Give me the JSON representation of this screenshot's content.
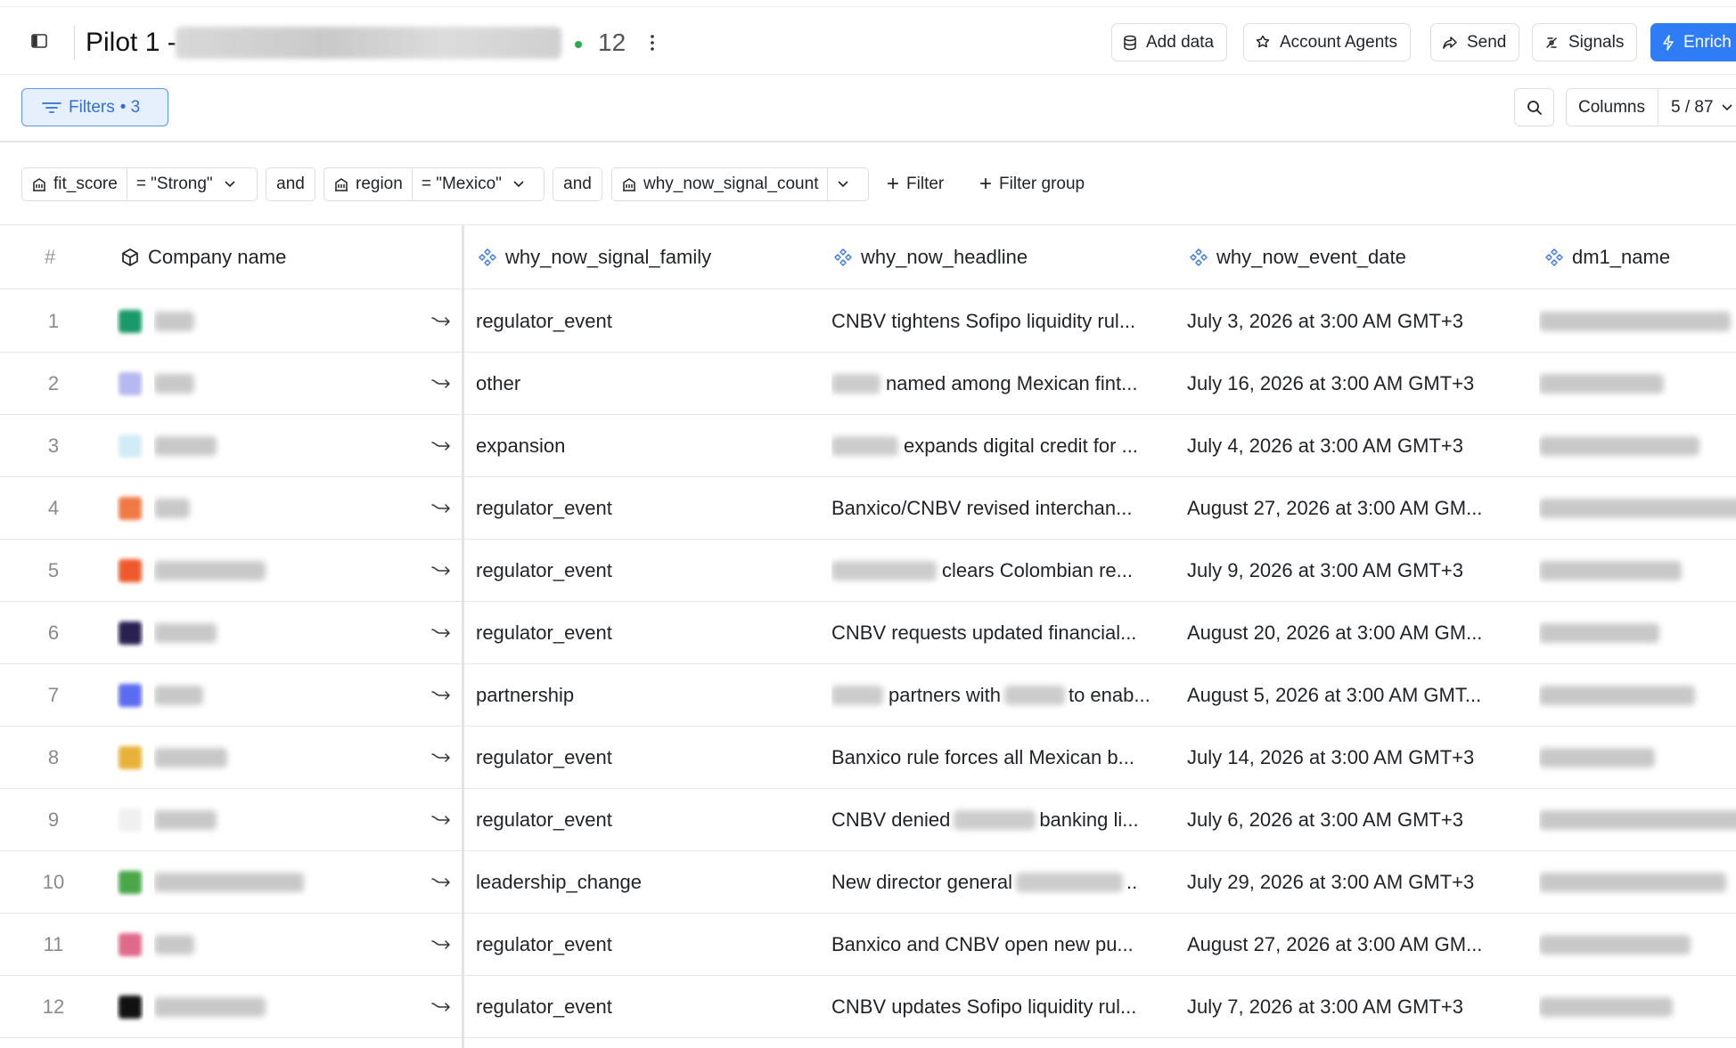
{
  "header": {
    "title": "Pilot 1 -",
    "row_count": "12",
    "buttons": {
      "add_data": "Add data",
      "account_agents": "Account Agents",
      "send": "Send",
      "signals": "Signals",
      "enrich": "Enrich"
    }
  },
  "toolbar": {
    "filters_label": "Filters",
    "filters_count": "• 3",
    "columns_label": "Columns",
    "columns_count": "5 / 87"
  },
  "filters": {
    "chip1": {
      "field": "fit_score",
      "value": "= \"Strong\""
    },
    "and1": "and",
    "chip2": {
      "field": "region",
      "value": "= \"Mexico\""
    },
    "and2": "and",
    "chip3": {
      "field": "why_now_signal_count"
    },
    "add_filter": "Filter",
    "add_group": "Filter group"
  },
  "table": {
    "columns": {
      "num": "#",
      "company": "Company name",
      "family": "why_now_signal_family",
      "headline": "why_now_headline",
      "date": "why_now_event_date",
      "dm": "dm1_name"
    },
    "rows": [
      {
        "num": "1",
        "logo_color": "#1a9a6a",
        "family": "regulator_event",
        "headline": "CNBV tightens Sofipo liquidity rul...",
        "date": "July 3, 2026 at 3:00 AM GMT+3"
      },
      {
        "num": "2",
        "logo_color": "#b8b8f0",
        "family": "other",
        "headline": "named among Mexican fint...",
        "date": "July 16, 2026 at 3:00 AM GMT+3"
      },
      {
        "num": "3",
        "logo_color": "#d2ecf6",
        "family": "expansion",
        "headline": "expands digital credit for ...",
        "date": "July 4, 2026 at 3:00 AM GMT+3"
      },
      {
        "num": "4",
        "logo_color": "#f07a45",
        "family": "regulator_event",
        "headline": "Banxico/CNBV revised interchan...",
        "date": "August 27, 2026 at 3:00 AM GM..."
      },
      {
        "num": "5",
        "logo_color": "#ee5a2c",
        "family": "regulator_event",
        "headline": "clears Colombian re...",
        "date": "July 9, 2026 at 3:00 AM GMT+3"
      },
      {
        "num": "6",
        "logo_color": "#2a2150",
        "family": "regulator_event",
        "headline": "CNBV requests updated financial...",
        "date": "August 20, 2026 at 3:00 AM GM..."
      },
      {
        "num": "7",
        "logo_color": "#5b6cf0",
        "family": "partnership",
        "headline": "partners with",
        "headline_tail": "to enab...",
        "date": "August 5, 2026 at 3:00 AM GMT..."
      },
      {
        "num": "8",
        "logo_color": "#e8b23a",
        "family": "regulator_event",
        "headline": "Banxico rule forces all Mexican b...",
        "date": "July 14, 2026 at 3:00 AM GMT+3"
      },
      {
        "num": "9",
        "logo_color": "#f0f0f0",
        "family": "regulator_event",
        "headline": "CNBV denied",
        "headline_tail": "banking li...",
        "date": "July 6, 2026 at 3:00 AM GMT+3"
      },
      {
        "num": "10",
        "logo_color": "#4aa84a",
        "family": "leadership_change",
        "headline": "New director general",
        "headline_tail": "..",
        "date": "July 29, 2026 at 3:00 AM GMT+3"
      },
      {
        "num": "11",
        "logo_color": "#e06a8a",
        "family": "regulator_event",
        "headline": "Banxico and CNBV open new pu...",
        "date": "August 27, 2026 at 3:00 AM GM..."
      },
      {
        "num": "12",
        "logo_color": "#111111",
        "family": "regulator_event",
        "headline": "CNBV updates Sofipo liquidity rul...",
        "date": "July 7, 2026 at 3:00 AM GMT+3"
      }
    ]
  },
  "colors": {
    "accent": "#2f7df6",
    "status_dot": "#2ea84a",
    "filter_active_bg": "#e6f0fd"
  },
  "icons": {
    "sidebar": "sidebar-toggle-icon",
    "more": "kebab-icon",
    "database": "database-icon",
    "agents": "agents-icon",
    "send": "share-arrow-icon",
    "signals": "signal-icon",
    "enrich": "bolt-icon",
    "filter": "filter-lines-icon",
    "search": "search-icon",
    "company": "cube-icon",
    "field": "building-icon",
    "ai_column": "ai-sparkle-icon",
    "expand": "expand-arrow-icon"
  }
}
